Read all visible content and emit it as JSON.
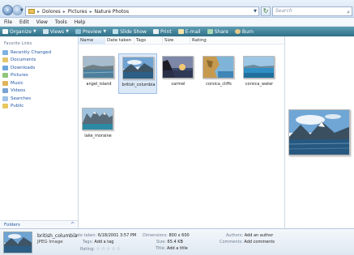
{
  "address": {
    "breadcrumbs": [
      "Dolores",
      "Pictures",
      "Nature Photos"
    ],
    "search_placeholder": "Search"
  },
  "menu": [
    "File",
    "Edit",
    "View",
    "Tools",
    "Help"
  ],
  "toolbar": [
    {
      "label": "Organize",
      "icon": "organize-icon",
      "caret": true
    },
    {
      "label": "Views",
      "icon": "views-icon",
      "caret": true
    },
    {
      "label": "Preview",
      "icon": "preview-icon",
      "caret": true
    },
    {
      "label": "Slide Show",
      "icon": "slideshow-icon",
      "caret": false
    },
    {
      "label": "Print",
      "icon": "print-icon",
      "caret": false
    },
    {
      "label": "E-mail",
      "icon": "email-icon",
      "caret": false
    },
    {
      "label": "Share",
      "icon": "share-icon",
      "caret": false
    },
    {
      "label": "Burn",
      "icon": "burn-icon",
      "caret": false
    }
  ],
  "favorites": {
    "heading": "Favorite Links",
    "items": [
      {
        "label": "Recently Changed",
        "icon": "recently-changed-icon"
      },
      {
        "label": "Documents",
        "icon": "documents-icon"
      },
      {
        "label": "Downloads",
        "icon": "downloads-icon"
      },
      {
        "label": "Pictures",
        "icon": "pictures-icon"
      },
      {
        "label": "Music",
        "icon": "music-icon"
      },
      {
        "label": "Videos",
        "icon": "videos-icon"
      },
      {
        "label": "Searches",
        "icon": "searches-icon"
      },
      {
        "label": "Public",
        "icon": "public-icon"
      }
    ],
    "folders_label": "Folders"
  },
  "columns": [
    "Name",
    "Date taken",
    "Tags",
    "Size",
    "Rating"
  ],
  "files": [
    {
      "name": "angel_island",
      "selected": false,
      "scene": "coast"
    },
    {
      "name": "british_columbia",
      "selected": true,
      "scene": "lake"
    },
    {
      "name": "carmel",
      "selected": false,
      "scene": "sunset"
    },
    {
      "name": "corsica_cliffs",
      "selected": false,
      "scene": "cliffs"
    },
    {
      "name": "corsica_water",
      "selected": false,
      "scene": "water"
    },
    {
      "name": "lake_moraine",
      "selected": false,
      "scene": "moraine"
    }
  ],
  "details": {
    "name": "british_columbia",
    "type": "JPEG Image",
    "date_taken_key": "Date taken:",
    "date_taken": "6/18/2001 3:57 PM",
    "tags_key": "Tags:",
    "tags": "Add a tag",
    "rating_key": "Rating:",
    "rating_stars": "☆☆☆☆☆",
    "dimensions_key": "Dimensions:",
    "dimensions": "800 x 600",
    "size_key": "Size:",
    "size": "65.4 KB",
    "title_key": "Title:",
    "title": "Add a title",
    "authors_key": "Authors:",
    "authors": "Add an author",
    "comments_key": "Comments:",
    "comments": "Add comments"
  },
  "colors": {
    "toolbar_top": "#5d9db3",
    "toolbar_bottom": "#2f6f87",
    "link_blue": "#1f57a5",
    "selection": "#dbe8f8"
  }
}
